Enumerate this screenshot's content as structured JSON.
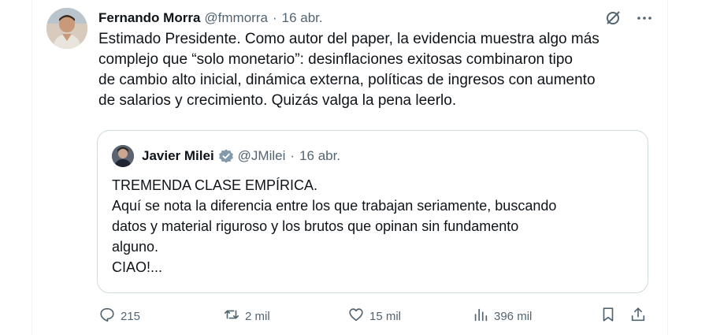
{
  "tweet": {
    "author_name": "Fernando Morra",
    "author_handle": "@fmmorra",
    "separator": "·",
    "date": "16 abr.",
    "text_lines": [
      "Estimado Presidente. Como autor del paper, la evidencia muestra algo más",
      "complejo que “solo monetario”: desinflaciones exitosas combinaron tipo",
      "de cambio alto inicial, dinámica externa, políticas de ingresos con aumento",
      "de salarios y crecimiento. Quizás valga la pena leerlo."
    ]
  },
  "quoted_tweet": {
    "author_name": "Javier Milei",
    "author_handle": "@JMilei",
    "separator": "·",
    "date": "16 abr.",
    "text_lines": [
      "TREMENDA CLASE EMPÍRICA.",
      "Aquí se nota la diferencia entre los que trabajan seriamente, buscando",
      "datos y material riguroso y los brutos que opinan sin fundamento",
      "alguno.",
      "CIAO!..."
    ]
  },
  "actions": {
    "replies": "215",
    "reposts": "2 mil",
    "likes": "15 mil",
    "views": "396 mil"
  },
  "icons": {
    "header": [
      "grok-icon",
      "more-icon"
    ],
    "actions": [
      "reply-icon",
      "repost-icon",
      "like-icon",
      "views-icon",
      "bookmark-icon",
      "share-icon"
    ]
  },
  "colors": {
    "text_primary": "#0f1419",
    "text_secondary": "#536471",
    "border": "#cfd9de",
    "verified_badge": "#829aab"
  }
}
